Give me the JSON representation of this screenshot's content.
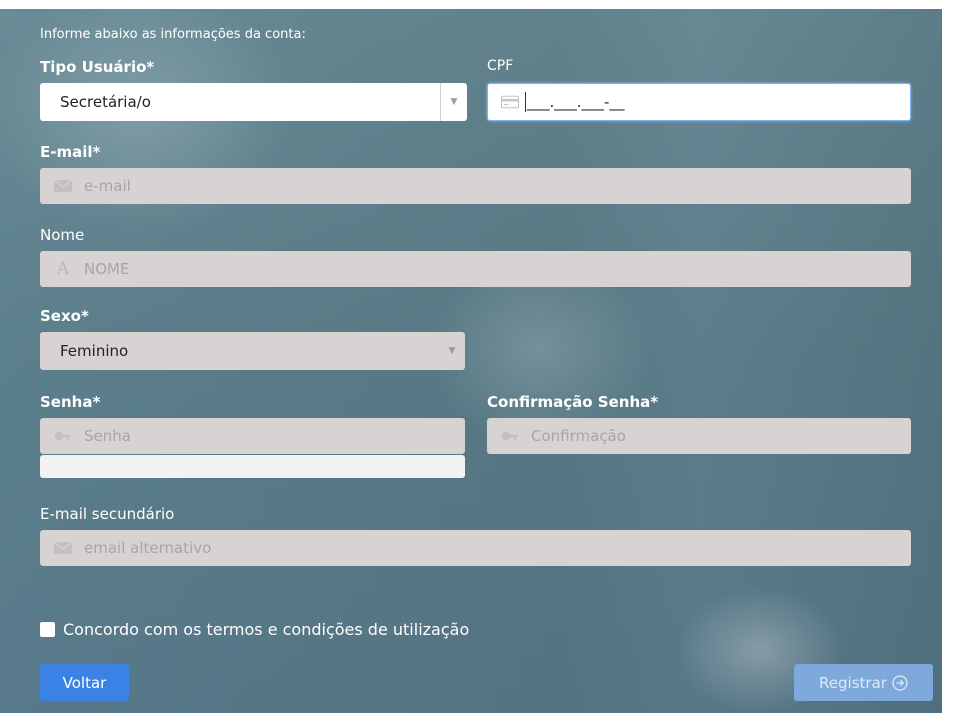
{
  "form": {
    "intro": "Informe abaixo as informações da conta:",
    "tipo_usuario": {
      "label": "Tipo Usuário*",
      "value": "Secretária/o"
    },
    "cpf": {
      "label": "CPF",
      "value": "___.___.___-__"
    },
    "email": {
      "label": "E-mail*",
      "placeholder": "e-mail"
    },
    "nome": {
      "label": "Nome",
      "placeholder": "NOME"
    },
    "sexo": {
      "label": "Sexo*",
      "value": "Feminino"
    },
    "senha": {
      "label": "Senha*",
      "placeholder": "Senha"
    },
    "confirmacao": {
      "label": "Confirmação Senha*",
      "placeholder": "Confirmação"
    },
    "email_secundario": {
      "label": "E-mail secundário",
      "placeholder": "email alternativo"
    },
    "terms": {
      "label": "Concordo com os termos e condições de utilização"
    }
  },
  "buttons": {
    "voltar": "Voltar",
    "registrar": "Registrar"
  },
  "colors": {
    "primary_button": "#3b82e6",
    "disabled_button": "#7fa9dc",
    "field_bg": "#d8d3d3",
    "focus_border": "#7fb3ee"
  },
  "icons": {
    "email": "envelope-icon",
    "nome": "letter-a-icon",
    "senha": "key-icon",
    "cpf": "id-card-icon",
    "registrar": "circle-arrow-right-icon"
  }
}
